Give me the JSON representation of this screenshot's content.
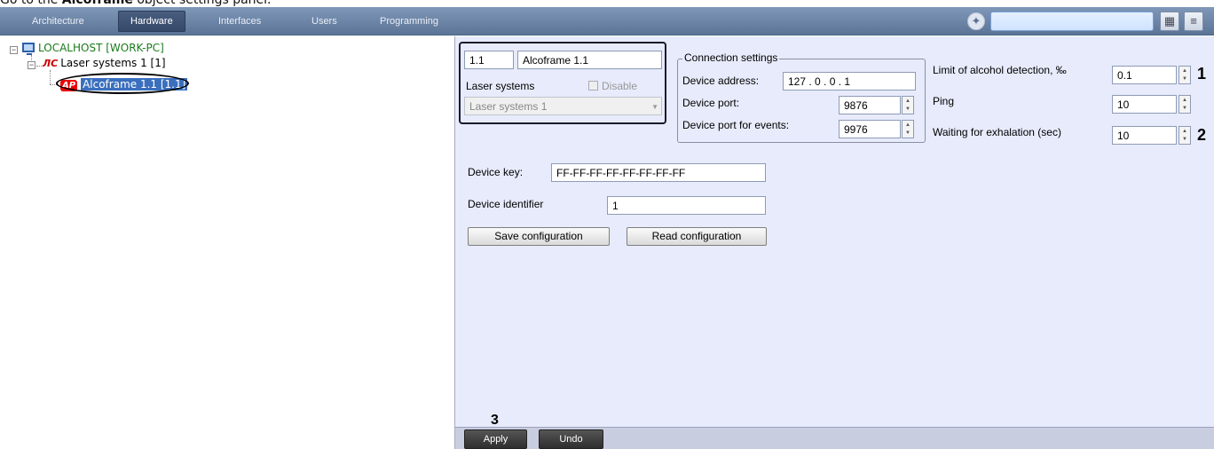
{
  "caption": {
    "prefix": "Go to the ",
    "bold": "Alcoframe",
    "suffix": " object settings panel."
  },
  "tabs": [
    {
      "label": "Architecture"
    },
    {
      "label": "Hardware"
    },
    {
      "label": "Interfaces"
    },
    {
      "label": "Users"
    },
    {
      "label": "Programming"
    }
  ],
  "active_tab": "Hardware",
  "tree": {
    "root": "LOCALHOST [WORK-PC]",
    "child_icon": "ЛС",
    "child": "Laser systems 1 [1]",
    "leaf_icon": "AP",
    "leaf": "Alcoframe 1.1 [1.1]"
  },
  "object": {
    "id": "1.1",
    "name": "Alcoframe 1.1",
    "parent_label": "Laser systems",
    "disable_label": "Disable",
    "parent_value": "Laser systems 1"
  },
  "connection": {
    "title": "Connection settings",
    "address_label": "Device address:",
    "address": "127 .   0   .   0   .  1",
    "port_label": "Device port:",
    "port": "9876",
    "events_port_label": "Device port for events:",
    "events_port": "9976"
  },
  "params": {
    "alcohol_label": "Limit of alcohol detection, ‰",
    "alcohol": "0.1",
    "ping_label": "Ping",
    "ping": "10",
    "wait_label": "Waiting for exhalation (sec)",
    "wait": "10"
  },
  "device": {
    "key_label": "Device key:",
    "key": "FF-FF-FF-FF-FF-FF-FF-FF",
    "identifier_label": "Device identifier",
    "identifier": "1",
    "save_label": "Save configuration",
    "read_label": "Read configuration"
  },
  "footer": {
    "apply": "Apply",
    "undo": "Undo"
  },
  "annotations": {
    "a1": "1",
    "a2": "2",
    "a3": "3"
  },
  "colors": {
    "panel": "#e7ebfb",
    "topbar": "#6f87aa",
    "selection": "#3a6fbe"
  }
}
